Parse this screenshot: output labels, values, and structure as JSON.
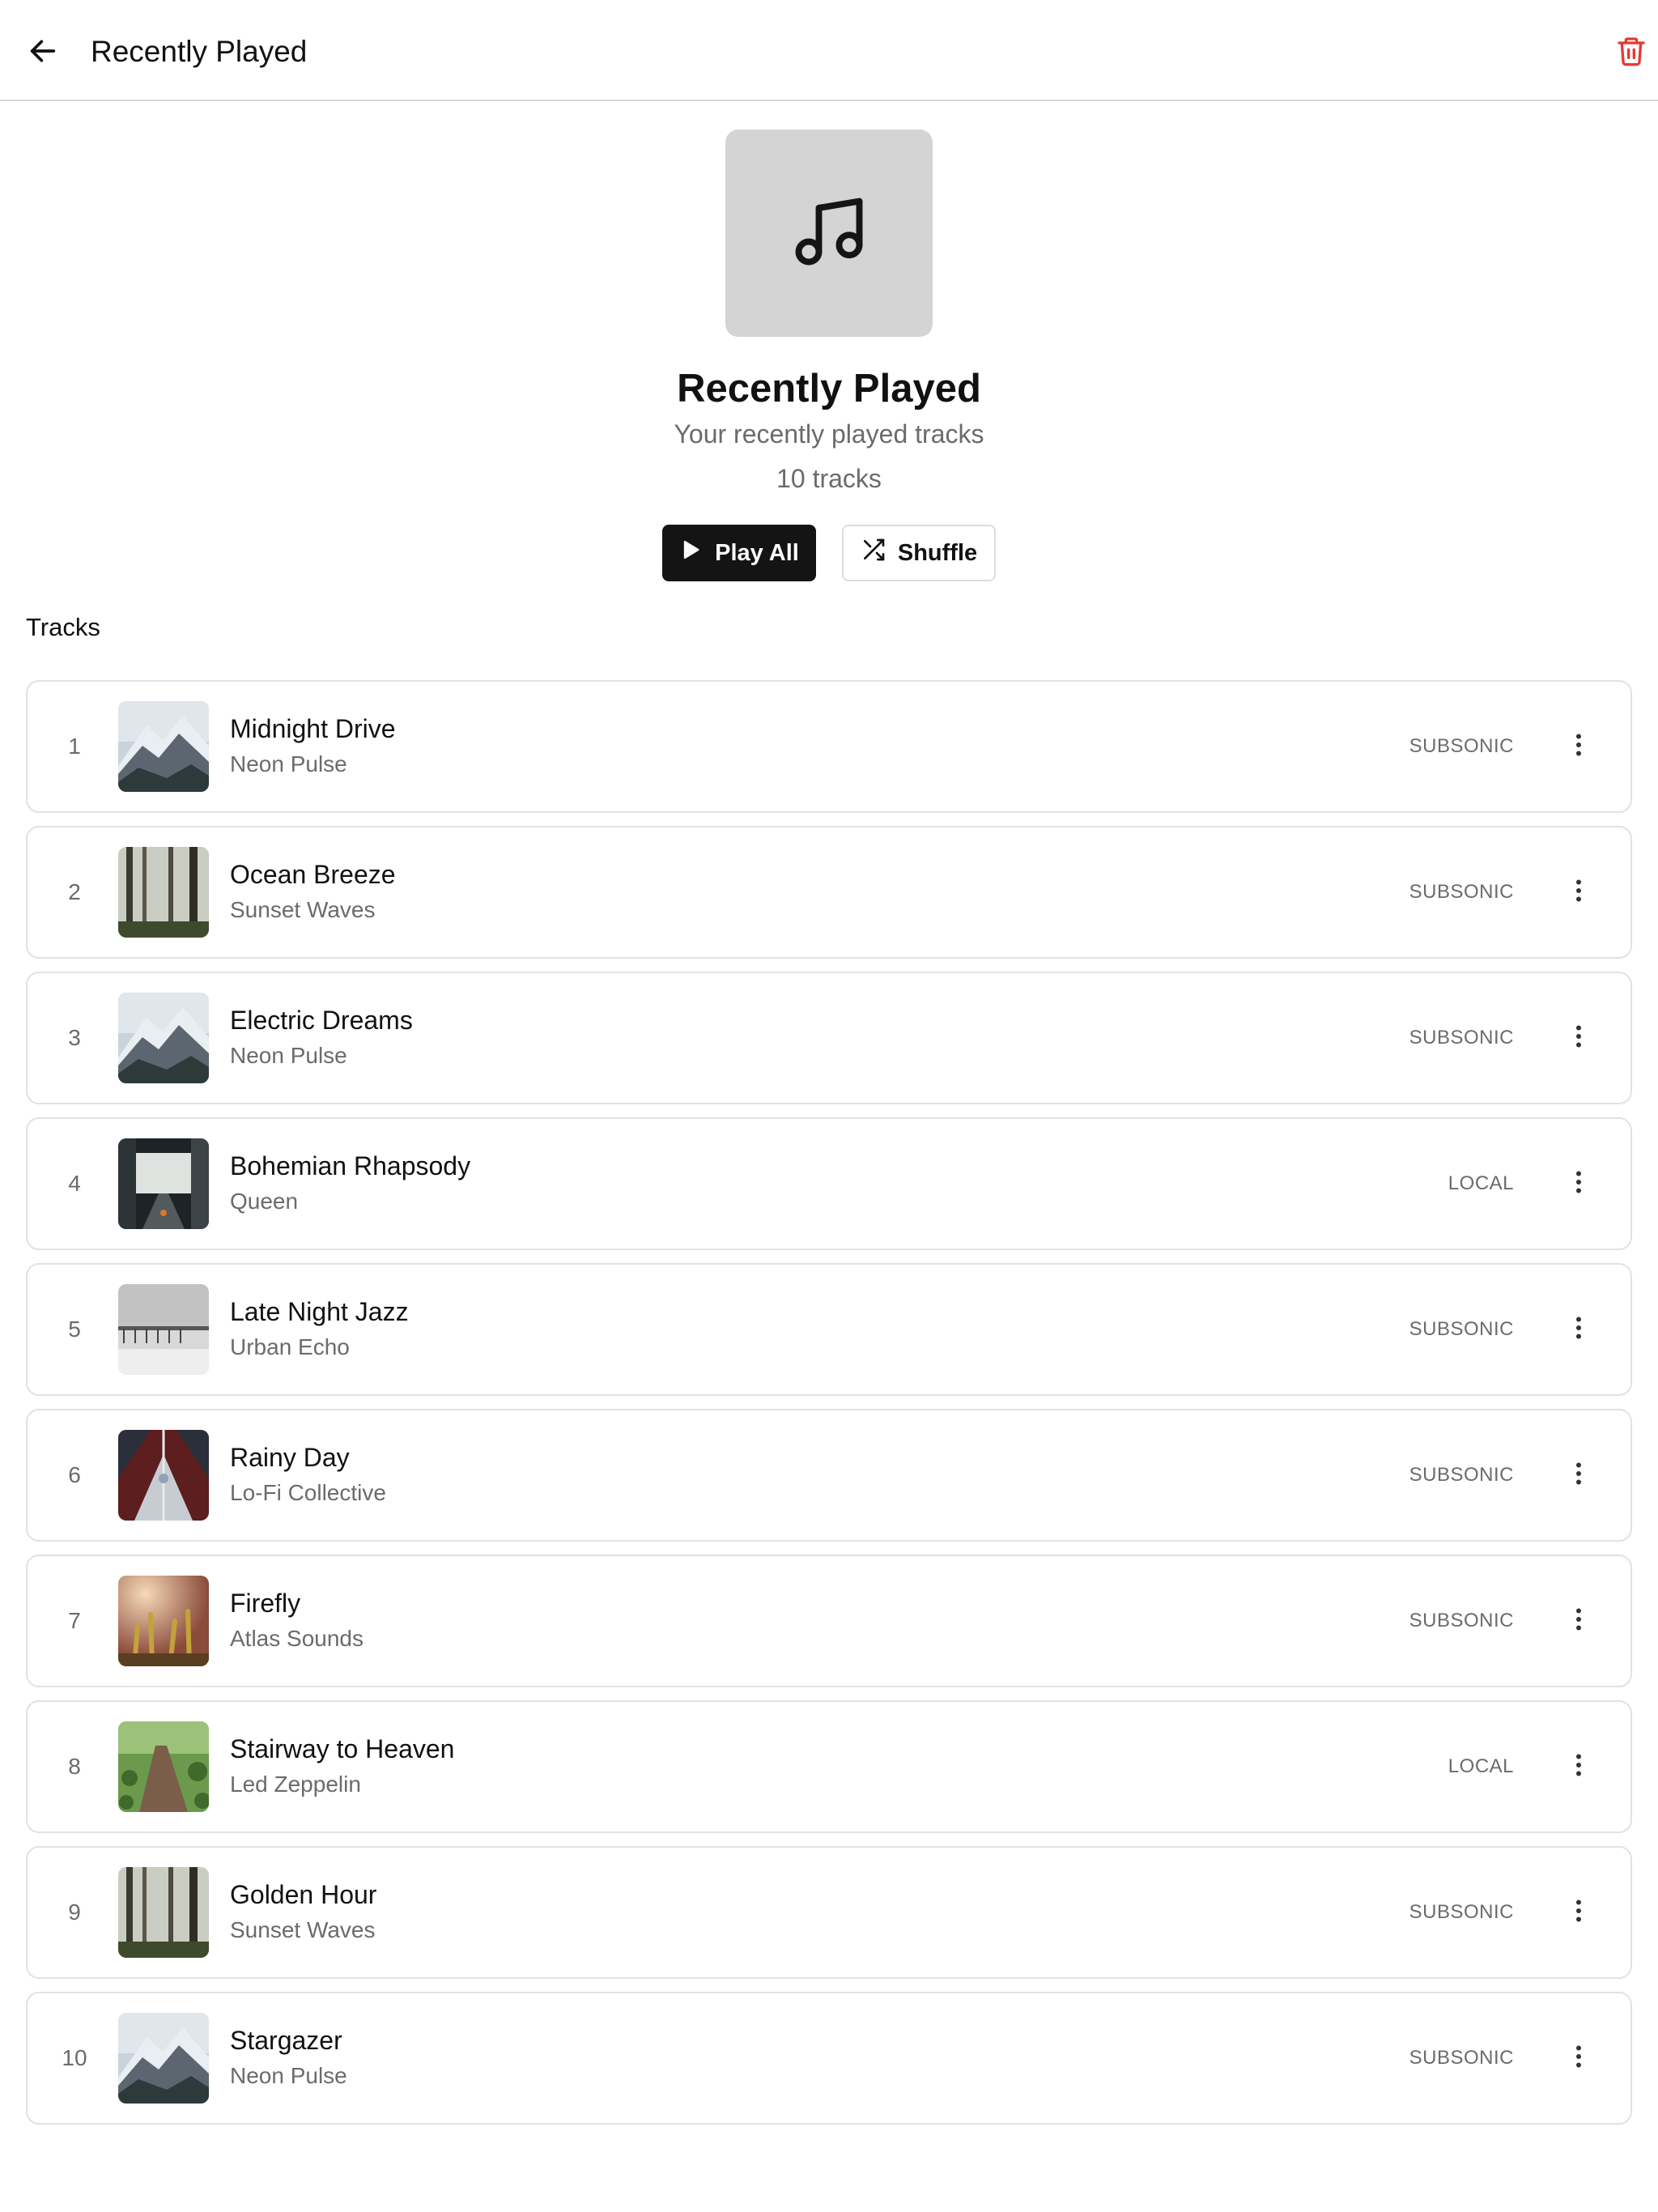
{
  "header": {
    "title": "Recently Played",
    "back_icon": "arrow-left-icon",
    "delete_icon": "trash-icon",
    "delete_color": "#e53935"
  },
  "playlist": {
    "cover_icon": "music-note-icon",
    "title": "Recently Played",
    "description": "Your recently played tracks",
    "count": "10 tracks"
  },
  "actions": {
    "play_all": "Play All",
    "shuffle": "Shuffle"
  },
  "section": {
    "label": "Tracks"
  },
  "tracks": [
    {
      "index": "1",
      "title": "Midnight Drive",
      "artist": "Neon Pulse",
      "source": "SUBSONIC",
      "art": "mountain"
    },
    {
      "index": "2",
      "title": "Ocean Breeze",
      "artist": "Sunset Waves",
      "source": "SUBSONIC",
      "art": "forest"
    },
    {
      "index": "3",
      "title": "Electric Dreams",
      "artist": "Neon Pulse",
      "source": "SUBSONIC",
      "art": "mountain"
    },
    {
      "index": "4",
      "title": "Bohemian Rhapsody",
      "artist": "Queen",
      "source": "LOCAL",
      "art": "street"
    },
    {
      "index": "5",
      "title": "Late Night Jazz",
      "artist": "Urban Echo",
      "source": "SUBSONIC",
      "art": "pier"
    },
    {
      "index": "6",
      "title": "Rainy Day",
      "artist": "Lo-Fi Collective",
      "source": "SUBSONIC",
      "art": "boat"
    },
    {
      "index": "7",
      "title": "Firefly",
      "artist": "Atlas Sounds",
      "source": "SUBSONIC",
      "art": "plants"
    },
    {
      "index": "8",
      "title": "Stairway to Heaven",
      "artist": "Led Zeppelin",
      "source": "LOCAL",
      "art": "path"
    },
    {
      "index": "9",
      "title": "Golden Hour",
      "artist": "Sunset Waves",
      "source": "SUBSONIC",
      "art": "forest"
    },
    {
      "index": "10",
      "title": "Stargazer",
      "artist": "Neon Pulse",
      "source": "SUBSONIC",
      "art": "mountain"
    }
  ]
}
